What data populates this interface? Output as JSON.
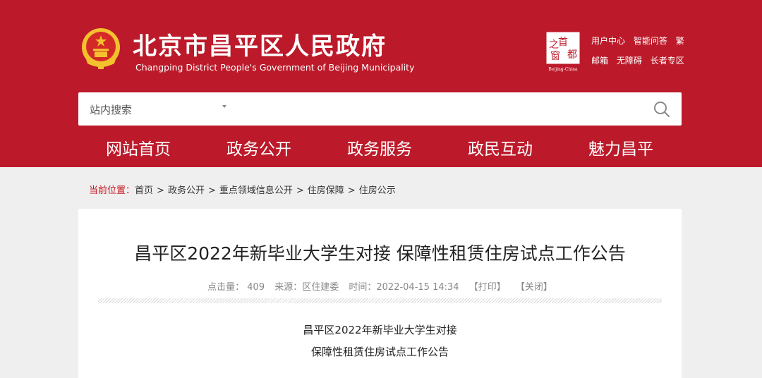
{
  "header": {
    "title": "北京市昌平区人民政府",
    "subtitle": "Changping District People's Government of Beijing Municipality",
    "seal": {
      "chars": [
        "首",
        "都",
        "之",
        "窗"
      ],
      "caption": "Beijing-China"
    },
    "top_links_row1": [
      "用户中心",
      "智能问答",
      "繁"
    ],
    "top_links_row2": [
      "邮箱",
      "无障碍",
      "长者专区"
    ]
  },
  "search": {
    "scope": "站内搜索",
    "value": ""
  },
  "nav": [
    "网站首页",
    "政务公开",
    "政务服务",
    "政民互动",
    "魅力昌平"
  ],
  "breadcrumb": {
    "label": "当前位置：",
    "items": [
      "首页",
      "政务公开",
      "重点领域信息公开",
      "住房保障",
      "住房公示"
    ],
    "separator": ">"
  },
  "article": {
    "title": "昌平区2022年新毕业大学生对接 保障性租赁住房试点工作公告",
    "meta": {
      "hits": "点击量：  409",
      "source": "来源：区住建委",
      "time": "时间：2022-04-15 14:34",
      "print": "【打印】",
      "close": "【关闭】"
    },
    "body_lines": [
      "昌平区2022年新毕业大学生对接",
      "保障性租赁住房试点工作公告"
    ]
  },
  "colors": {
    "brand_red": "#bc1a2a",
    "emblem_gold": "#f3c12e",
    "breadcrumb_current": "#c8161e"
  }
}
